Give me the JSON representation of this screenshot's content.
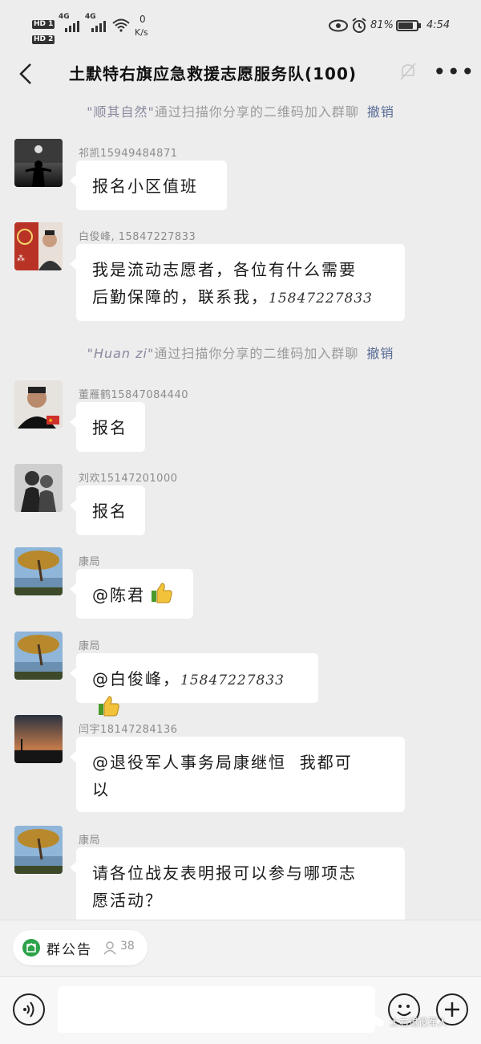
{
  "status_bar": {
    "sim1": "HD 1",
    "sim2": "HD 2",
    "net1": "4G",
    "net2": "4G",
    "speed_value": "0",
    "speed_unit": "K/s",
    "battery": "81%",
    "battery_level": 0.81,
    "time": "4:54"
  },
  "header": {
    "title": "土默特右旗应急救援志愿服务队(100)",
    "back_icon": "chevron-left-icon",
    "mute_icon": "bell-off-icon",
    "more_icon": "more-icon"
  },
  "system_messages": [
    {
      "quote": "\"顺其自然\"",
      "text": "通过扫描你分享的二维码加入群聊",
      "action": "撤销"
    },
    {
      "quote": "\"Huan zi\"",
      "text": "通过扫描你分享的二维码加入群聊",
      "action": "撤销"
    }
  ],
  "messages": [
    {
      "name": "祁凯15949484871",
      "line1": "报名小区值班"
    },
    {
      "name": "白俊峰, 15847227833",
      "line1": "我是流动志愿者，各位有什么需要",
      "line2_text": "后勤保障的，联系我，",
      "line2_num": "15847227833"
    },
    {
      "name": "董雁鹤15847084440",
      "line1": "报名"
    },
    {
      "name": "刘欢15147201000",
      "line1": "报名"
    },
    {
      "name": "康局",
      "line1": "@陈君",
      "icon": "thumbs-up-icon"
    },
    {
      "name": "康局",
      "line1_text": "@白俊峰，",
      "line1_num": "15847227833",
      "icon": "thumbs-up-icon"
    },
    {
      "name": "闫宇18147284136",
      "line1": "@退役军人事务局康继恒  我都可",
      "line2": "以"
    },
    {
      "name": "康局",
      "line1": "请各位战友表明报可以参与哪项志",
      "line2": "愿活动？"
    }
  ],
  "bottom": {
    "notice_label": "群公告",
    "member_count": "38",
    "voice_icon": "voice-icon",
    "emoji_icon": "emoji-icon",
    "add_icon": "plus-icon",
    "watermark": "土右退役军人"
  }
}
